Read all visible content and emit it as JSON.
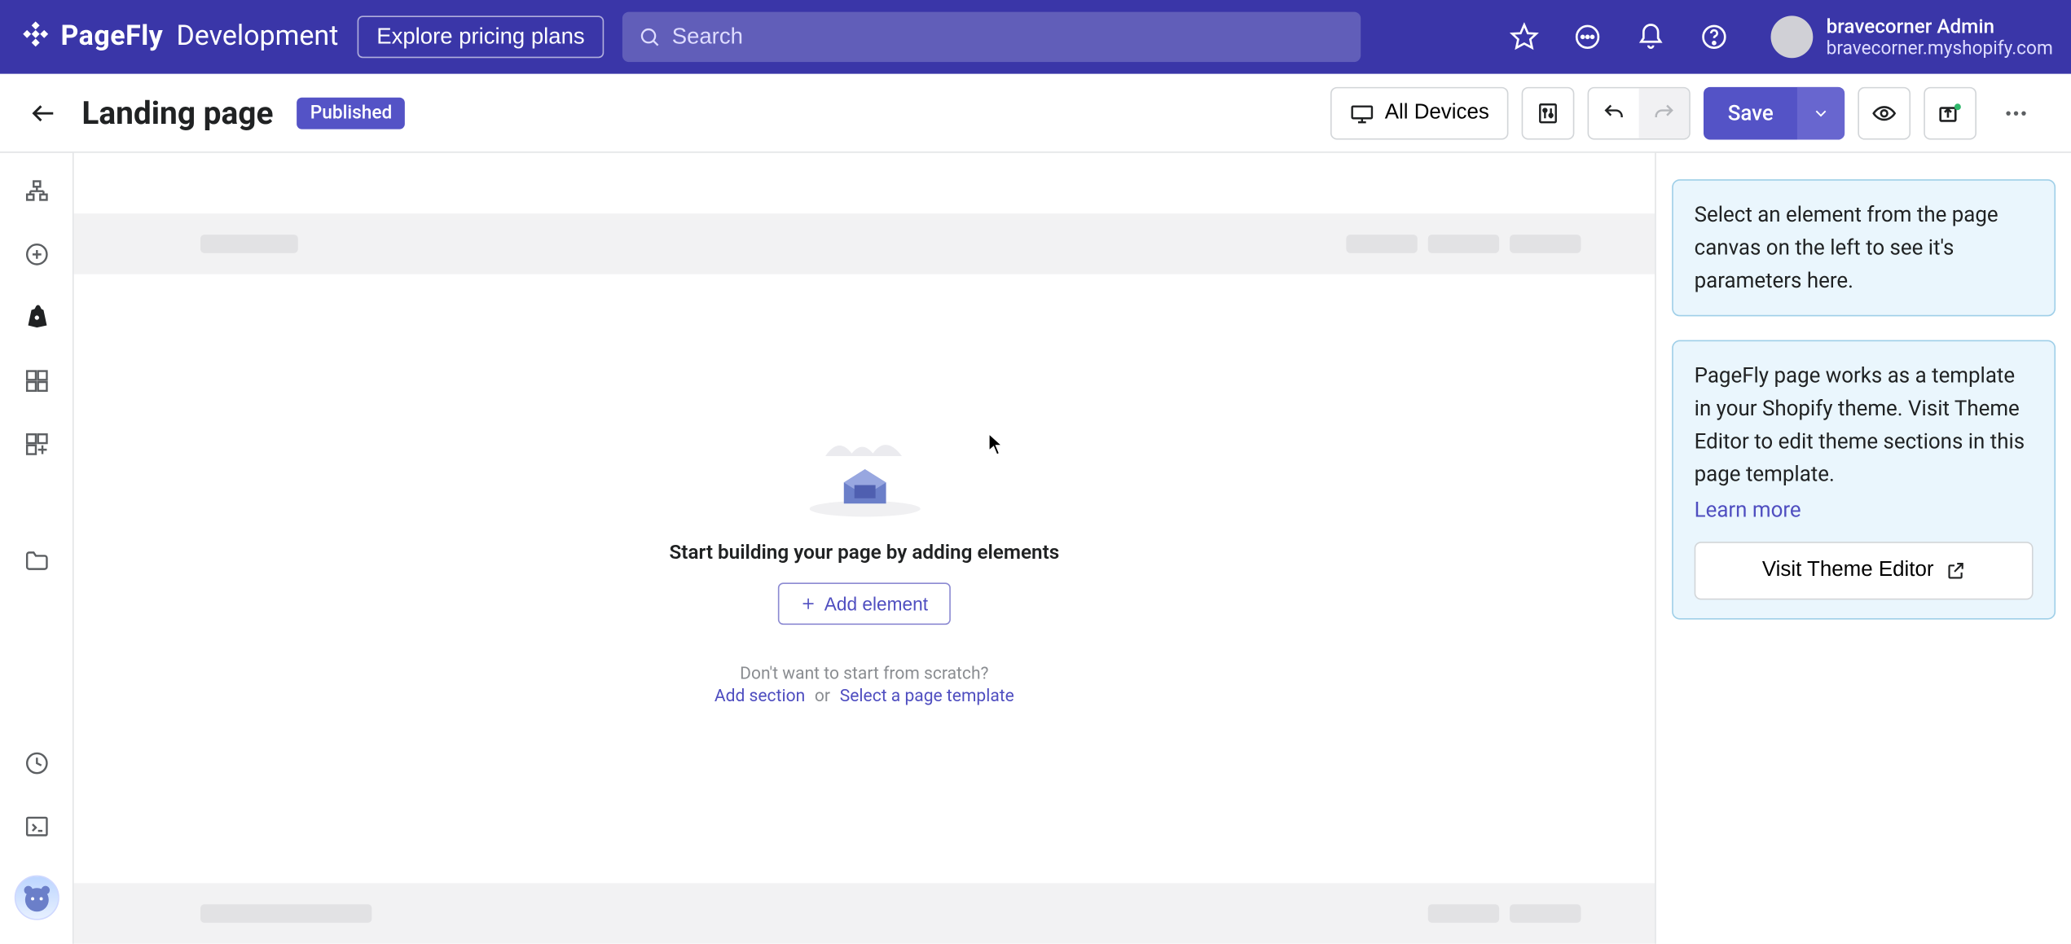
{
  "header": {
    "brand": "PageFly",
    "env": "Development",
    "explore_label": "Explore pricing plans",
    "search_placeholder": "Search",
    "user_name": "bravecorner Admin",
    "user_shop": "bravecorner.myshopify.com"
  },
  "subheader": {
    "title": "Landing page",
    "status_chip": "Published",
    "devices_label": "All Devices",
    "save_label": "Save"
  },
  "canvas": {
    "empty_title": "Start building your page by adding elements",
    "add_element_label": "Add element",
    "hint": "Don't want to start from scratch?",
    "add_section": "Add section",
    "or": "or",
    "select_template": "Select a page template"
  },
  "rightpanel": {
    "info1": "Select an element from the page canvas on the left to see it's parameters here.",
    "info2": "PageFly page works as a template in your Shopify theme. Visit Theme Editor to edit theme sections in this page template.",
    "learn_more": "Learn more",
    "visit_btn": "Visit Theme Editor"
  }
}
